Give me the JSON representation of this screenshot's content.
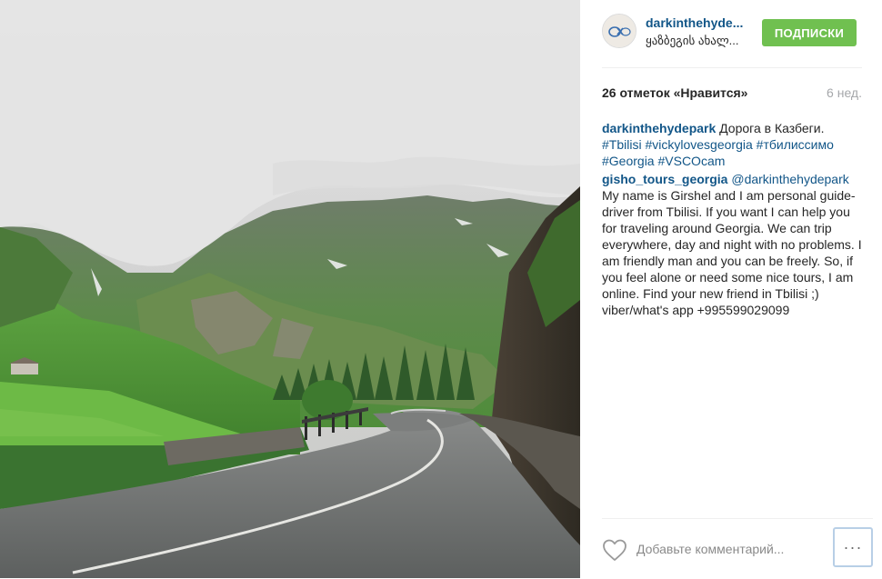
{
  "post": {
    "photo_description_icon": "mountain-road-photo",
    "author": {
      "username": "darkinthehyde...",
      "location": "ყაზბეგის ახალ..."
    },
    "follow_label": "ПОДПИСКИ",
    "likes": "26 отметок «Нравится»",
    "time_ago": "6 нед.",
    "comments": [
      {
        "user": "darkinthehydepark",
        "text": " Дорога в Казбеги.",
        "tags": [
          "#Tbilisi",
          "#vickylovesgeorgia",
          "#тбилиссимо",
          "#Georgia",
          "#VSCOcam"
        ]
      },
      {
        "user": "gisho_tours_georgia",
        "mention": "@darkinthehydepark",
        "text": "My name is Girshel and I am personal guide-driver from Tbilisi. If you want I can help you for traveling around Georgia. We can trip everywhere, day and night with no problems. I am friendly man and you can be freely. So, if you feel alone or need some nice tours, I am online. Find your new friend in Tbilisi ;) viber/what's app +995599029099"
      }
    ],
    "comment_placeholder": "Добавьте комментарий...",
    "more_label": "···"
  },
  "colors": {
    "link": "#125688",
    "follow_button": "#70c050",
    "muted": "#a5a7aa"
  }
}
